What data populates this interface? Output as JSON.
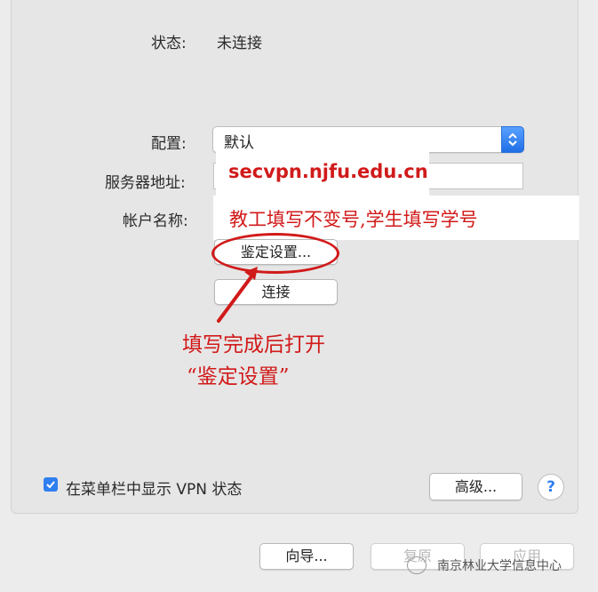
{
  "status": {
    "label": "状态:",
    "value": "未连接"
  },
  "config": {
    "label": "配置:",
    "selected": "默认"
  },
  "server": {
    "label": "服务器地址:",
    "value": "secvpn.njfu.edu.cn"
  },
  "account": {
    "label": "帐户名称:",
    "note": "教工填写不变号,学生填写学号"
  },
  "buttons": {
    "auth_settings": "鉴定设置...",
    "connect": "连接",
    "advanced": "高级...",
    "help": "?",
    "wizard": "向导...",
    "revert": "复原",
    "apply": "应用"
  },
  "annotation": {
    "line1": "填写完成后打开",
    "line2": "“鉴定设置”"
  },
  "checkbox": {
    "label": "在菜单栏中显示 VPN 状态",
    "checked": true
  },
  "watermark": "南京林业大学信息中心",
  "colors": {
    "annotation": "#d11a1a",
    "accent": "#2f7ff0"
  }
}
